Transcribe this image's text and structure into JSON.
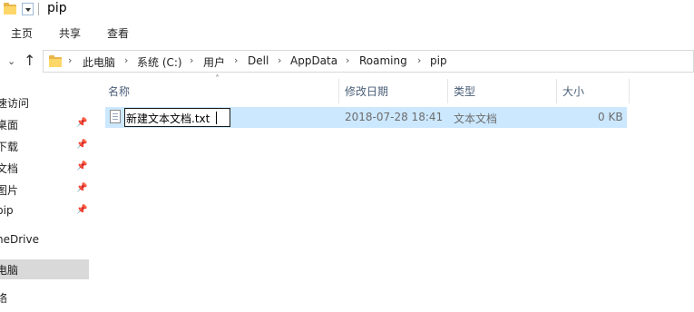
{
  "window": {
    "title": "pip"
  },
  "ribbon": {
    "tabs": [
      "主页",
      "共享",
      "查看"
    ]
  },
  "address": {
    "crumbs": [
      "此电脑",
      "系统 (C:)",
      "用户",
      "Dell",
      "AppData",
      "Roaming",
      "pip"
    ]
  },
  "nav_pane": {
    "items": [
      {
        "label": "速访问",
        "pinned": false
      },
      {
        "label": "桌面",
        "pinned": true
      },
      {
        "label": "下载",
        "pinned": true
      },
      {
        "label": "文档",
        "pinned": true
      },
      {
        "label": "图片",
        "pinned": true
      },
      {
        "label": "pip",
        "pinned": true
      },
      {
        "label": "neDrive",
        "pinned": false
      },
      {
        "label": "电脑",
        "pinned": false,
        "selected": true
      },
      {
        "label": "络",
        "pinned": false
      }
    ]
  },
  "columns": {
    "name": "名称",
    "modified": "修改日期",
    "type": "类型",
    "size": "大小"
  },
  "files": [
    {
      "name": "新建文本文档.txt",
      "modified": "2018-07-28 18:41",
      "type": "文本文档",
      "size": "0 KB",
      "renaming": true
    }
  ],
  "icons": {
    "folder": "folder-icon",
    "file": "text-file-icon",
    "pin": "pin-icon",
    "up": "up-arrow-icon"
  },
  "colors": {
    "selection": "#cce8ff",
    "folder": "#ffd768",
    "column_header_text": "#4c607a"
  }
}
